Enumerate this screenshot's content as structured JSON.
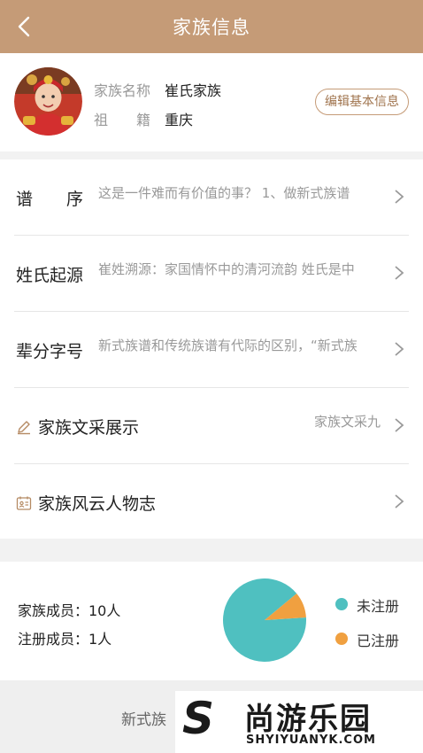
{
  "header": {
    "title": "家族信息",
    "back_icon": "chevron-left-icon"
  },
  "profile": {
    "name_label": "家族名称",
    "name_value": "崔氏家族",
    "origin_label": "祖　　籍",
    "origin_value": "重庆",
    "edit_button": "编辑基本信息"
  },
  "menu": [
    {
      "label": "谱　　序",
      "desc": "这是一件难而有价值的事？ 1、做新式族谱"
    },
    {
      "label": "姓氏起源",
      "desc": "崔姓溯源：家国情怀中的清河流韵 姓氏是中"
    },
    {
      "label": "辈分字号",
      "desc": "新式族谱和传统族谱有代际的区别，“新式族"
    },
    {
      "label": "家族文采展示",
      "desc": "家族文采九",
      "icon": "pen-icon"
    },
    {
      "label": "家族风云人物志",
      "desc": "",
      "icon": "id-card-icon"
    }
  ],
  "stats": {
    "members": "家族成员：10人",
    "registered": "注册成员：1人"
  },
  "chart_data": {
    "type": "pie",
    "slices": [
      {
        "name": "未注册",
        "value": 9,
        "color": "#4fc0c0"
      },
      {
        "name": "已注册",
        "value": 1,
        "color": "#f0a040"
      }
    ]
  },
  "footer": {
    "text": "新式族"
  },
  "watermark": {
    "logo": "S",
    "main": "尚游乐园",
    "sub": "SHYIYUANYK.COM"
  },
  "colors": {
    "accent": "#c59b77",
    "teal": "#4fc0c0",
    "orange": "#f0a040"
  }
}
